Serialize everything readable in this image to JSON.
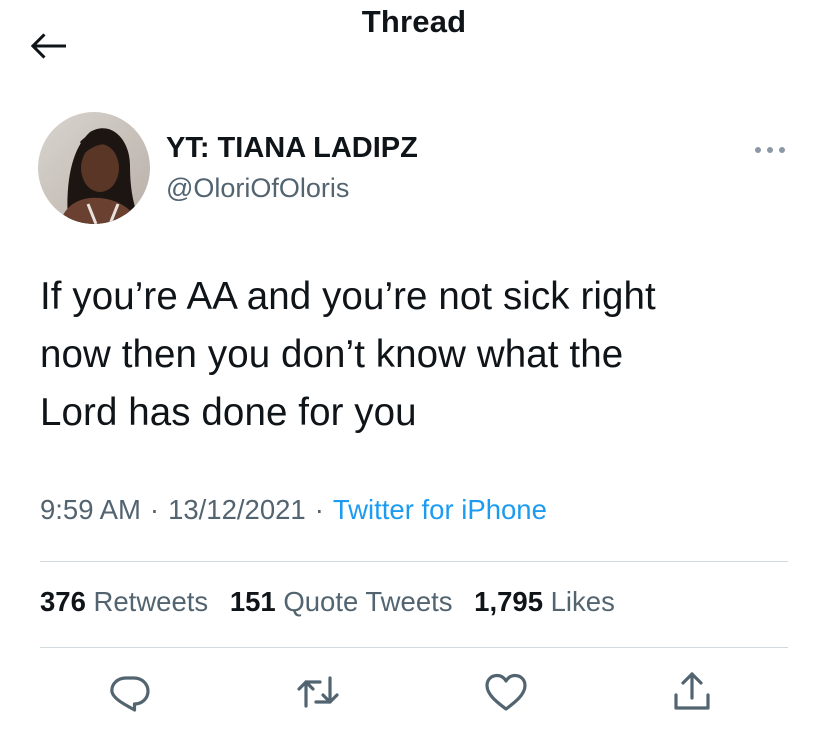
{
  "header": {
    "title": "Thread",
    "back_icon": "arrow-left-icon"
  },
  "author": {
    "display_name": "YT: TIANA LADIPZ",
    "handle": "@OloriOfOloris",
    "more_icon": "more-dots-icon"
  },
  "tweet": {
    "text_lines": [
      "If you’re AA and you’re not sick right",
      "now then you don’t know what the",
      "Lord has done for you"
    ],
    "time": "9:59 AM",
    "date": "13/12/2021",
    "separator": "·",
    "source": "Twitter for iPhone"
  },
  "stats": {
    "retweets_count": "376",
    "retweets_label": "Retweets",
    "quotes_count": "151",
    "quotes_label": "Quote Tweets",
    "likes_count": "1,795",
    "likes_label": "Likes"
  },
  "actions": [
    "reply-icon",
    "retweet-icon",
    "like-icon",
    "share-icon"
  ],
  "colors": {
    "text_primary": "#0f1419",
    "text_secondary": "#536471",
    "accent": "#1d9bf0",
    "divider": "#cfd9de"
  }
}
